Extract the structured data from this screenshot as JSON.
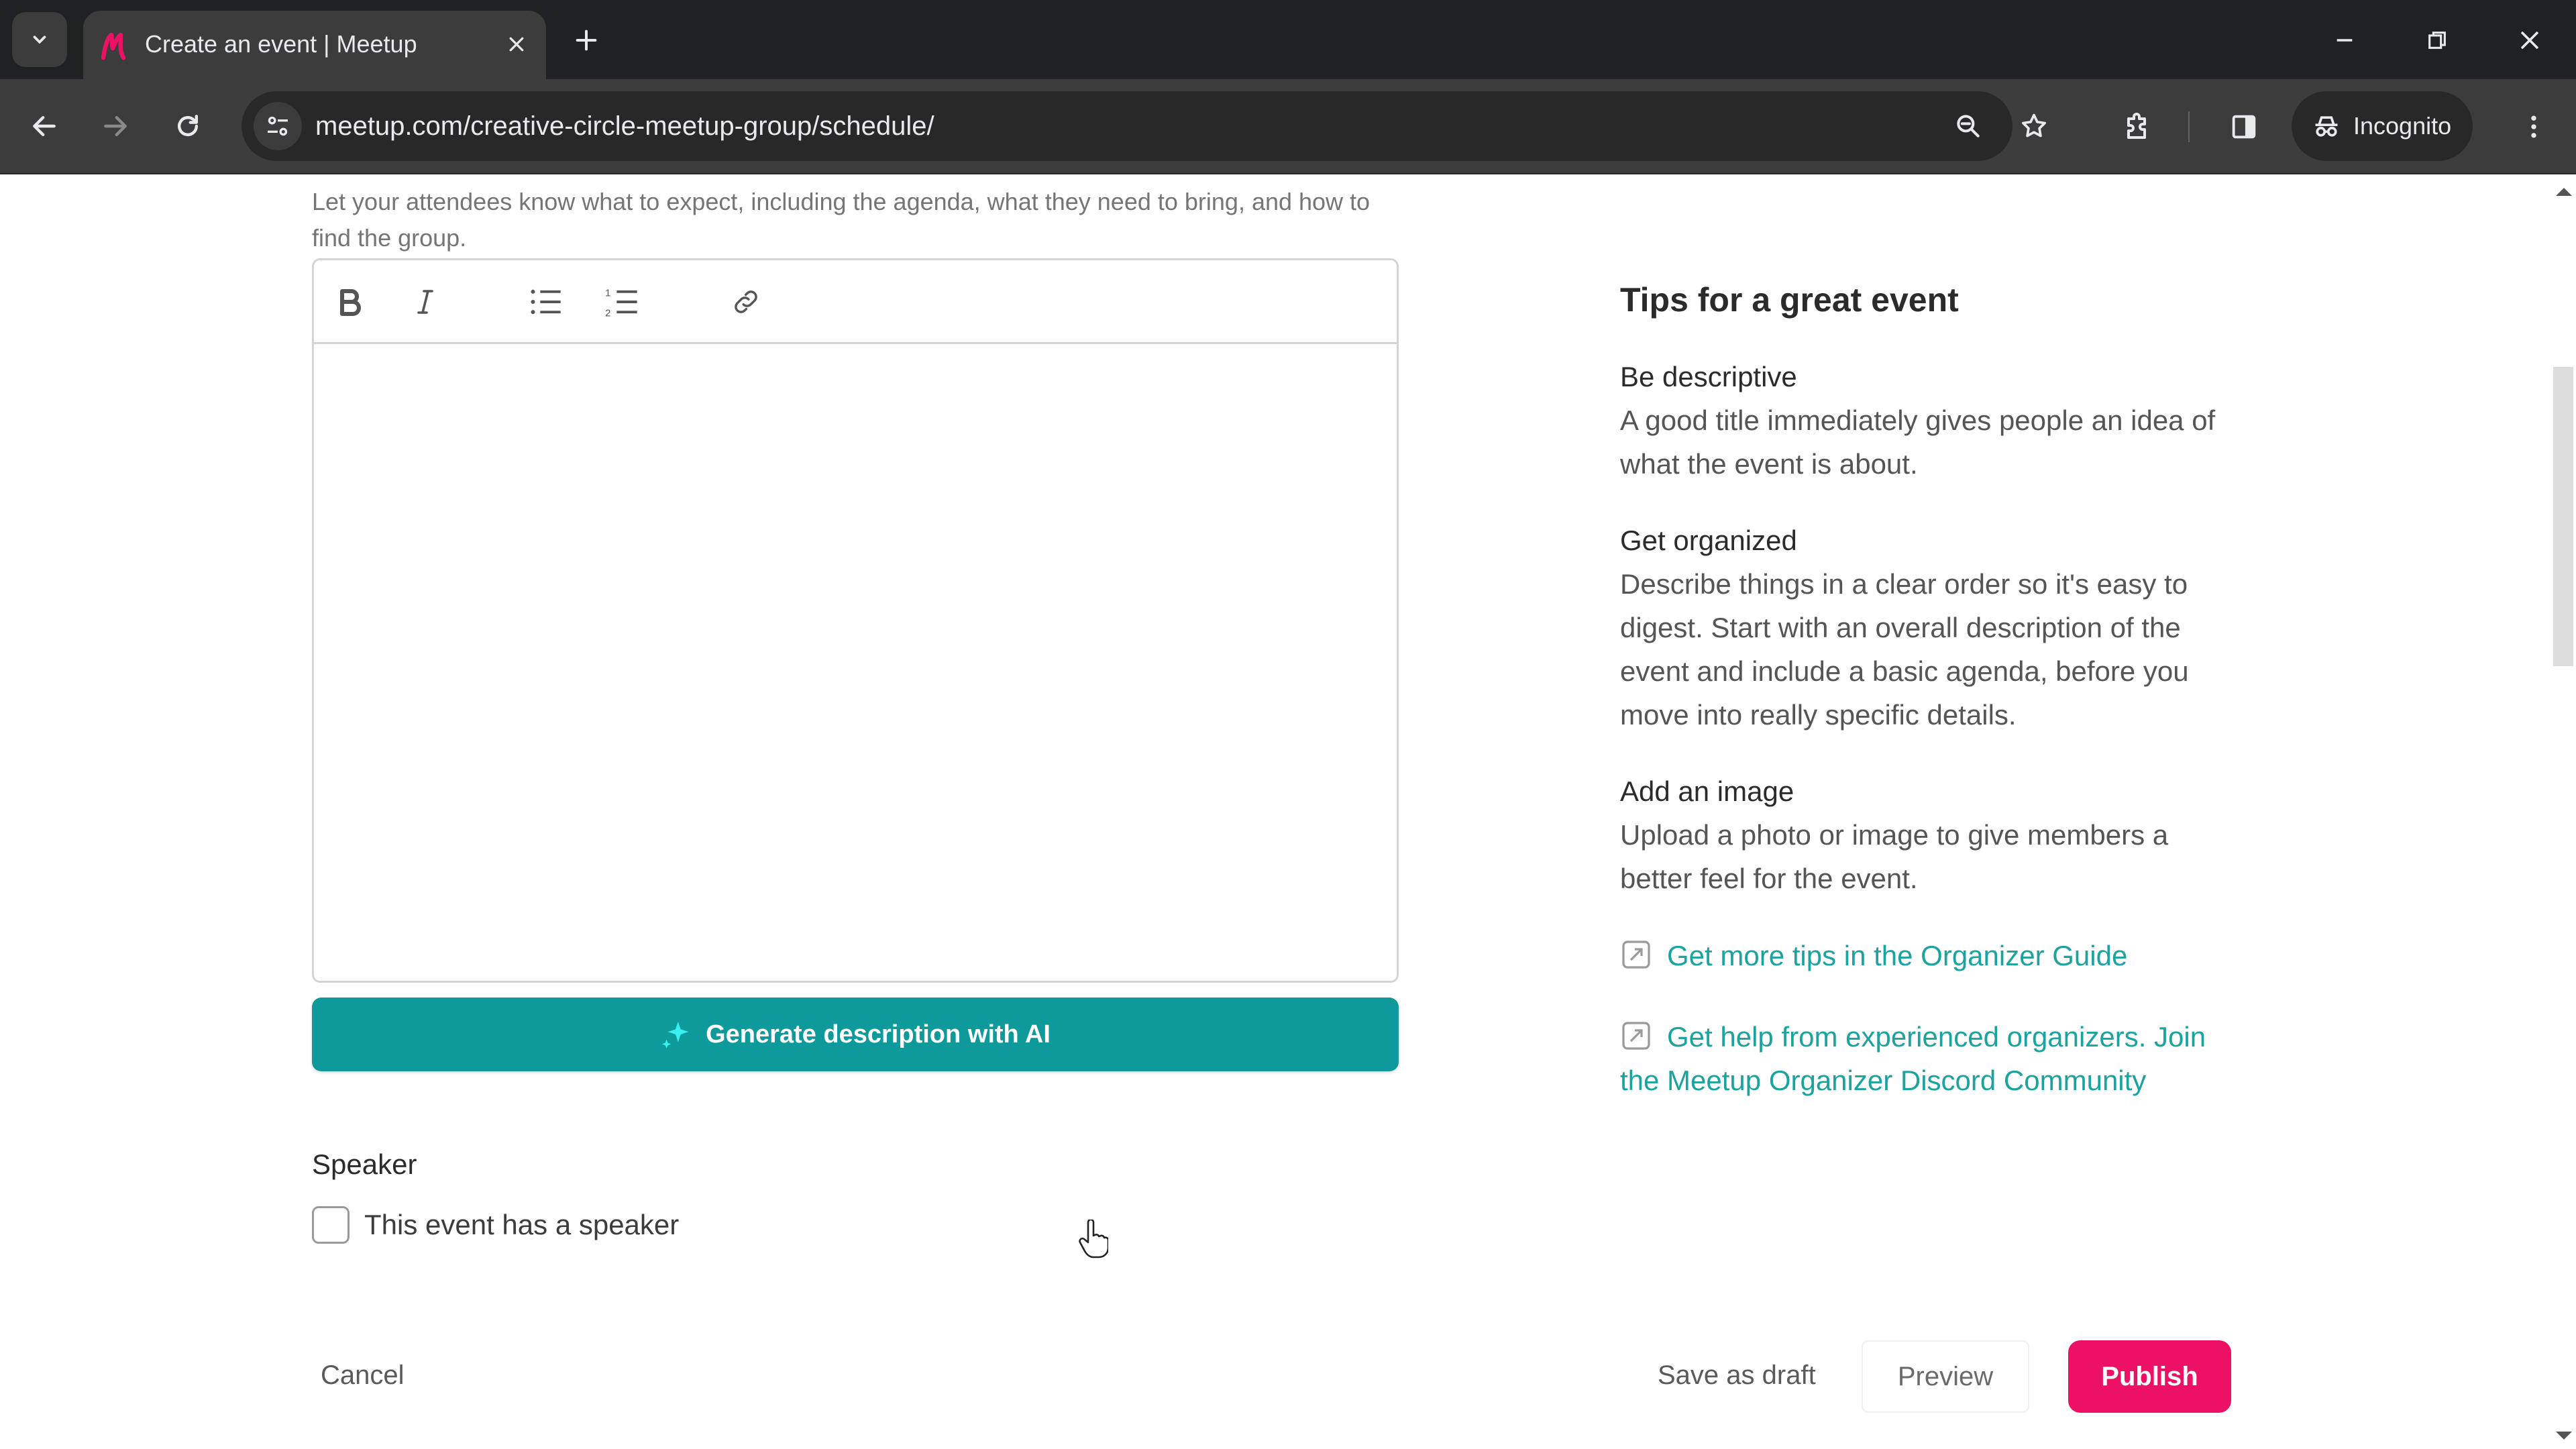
{
  "browser": {
    "tab_title": "Create an event | Meetup",
    "url": "meetup.com/creative-circle-meetup-group/schedule/",
    "incognito_label": "Incognito"
  },
  "colors": {
    "brand_pink": "#ed1165",
    "teal_accent": "#0e9a9a",
    "link_teal": "#1aa39f"
  },
  "description": {
    "hint": "Let your attendees know what to expect, including the agenda, what they need to bring, and how to find the group.",
    "editor_value": "",
    "toolbar": [
      "bold",
      "italic",
      "bullet-list",
      "numbered-list",
      "link"
    ],
    "ai_button_label": "Generate description with AI"
  },
  "speaker": {
    "label": "Speaker",
    "checkbox_label": "This event has a speaker",
    "checked": false
  },
  "tips": {
    "title": "Tips for a great event",
    "items": [
      {
        "heading": "Be descriptive",
        "body": "A good title immediately gives people an idea of what the event is about."
      },
      {
        "heading": "Get organized",
        "body": "Describe things in a clear order so it's easy to digest. Start with an overall description of the event and include a basic agenda, before you move into really specific details."
      },
      {
        "heading": "Add an image",
        "body": "Upload a photo or image to give members a better feel for the event."
      }
    ],
    "links": [
      "Get more tips in the Organizer Guide",
      "Get help from experienced organizers. Join the Meetup Organizer Discord Community"
    ]
  },
  "actions": {
    "cancel": "Cancel",
    "save_draft": "Save as draft",
    "preview": "Preview",
    "publish": "Publish"
  },
  "scroll": {
    "thumb_start_fraction": 0.15,
    "thumb_size_fraction": 0.235
  }
}
